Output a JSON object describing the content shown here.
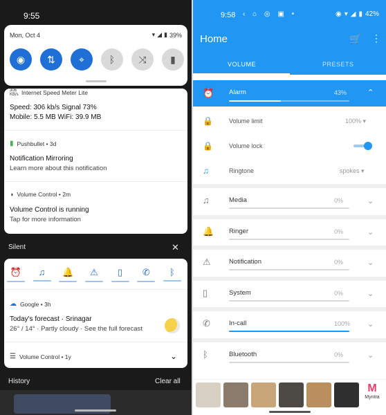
{
  "left": {
    "status_time": "9:55",
    "quick_settings": {
      "date": "Mon, Oct 4",
      "battery": "39%",
      "tiles": [
        {
          "name": "wifi-tile",
          "icon": "wifi-icon",
          "state": "on",
          "glyph": "◉"
        },
        {
          "name": "data-tile",
          "icon": "mobile-data-icon",
          "state": "on",
          "glyph": "⇅"
        },
        {
          "name": "location-tile",
          "icon": "location-icon",
          "state": "on",
          "glyph": "⌖"
        },
        {
          "name": "bluetooth-tile",
          "icon": "bluetooth-icon",
          "state": "off",
          "glyph": "ᛒ"
        },
        {
          "name": "autorotate-tile",
          "icon": "rotate-icon",
          "state": "off",
          "glyph": "⤨"
        },
        {
          "name": "flashlight-tile",
          "icon": "flashlight-icon",
          "state": "off",
          "glyph": "▮"
        }
      ]
    },
    "speed_notif": {
      "app": "Internet Speed Meter Lite",
      "app_badge": "306 KB/s",
      "line1": "Speed: 306 kb/s    Signal 73%",
      "line2": "Mobile: 5.5 MB    WiFi: 39.9 MB"
    },
    "pushbullet_notif": {
      "app": "Pushbullet • 3d",
      "title": "Notification Mirroring",
      "body": "Learn more about this notification"
    },
    "volume_notif": {
      "app": "Volume Control • 2m",
      "title": "Volume Control is running",
      "body": "Tap for more information"
    },
    "silent_label": "Silent",
    "silent_close": "✕",
    "volume_icons": [
      "⏰",
      "♫",
      "🔔",
      "⚠",
      "▯",
      "✆",
      "ᛒ"
    ],
    "google_notif": {
      "app": "Google • 3h",
      "title": "Today's forecast · Srinagar",
      "body": "26° / 14° · Partly cloudy · See the full forecast"
    },
    "vc_notif": {
      "app": "Volume Control • 1y",
      "chevron": "⌄"
    },
    "history": "History",
    "clear_all": "Clear all"
  },
  "right": {
    "status_time": "9:58",
    "status_icons_left": "‹ ⌂ ◎ ▣ •",
    "battery": "42%",
    "app_title": "Home",
    "tabs": [
      "VOLUME",
      "PRESETS"
    ],
    "alarm": {
      "label": "Alarm",
      "pct": "43%",
      "level": 0.43
    },
    "alarm_sub": {
      "volume_limit": {
        "label": "Volume limit",
        "value": "100% ▾"
      },
      "volume_lock": {
        "label": "Volume lock",
        "state": "on"
      },
      "ringtone": {
        "label": "Ringtone",
        "value": "spokes ▾"
      }
    },
    "streams": [
      {
        "key": "media",
        "label": "Media",
        "pct": "0%",
        "level": 0.0,
        "icon": "music-note-icon",
        "glyph": "♫"
      },
      {
        "key": "ringer",
        "label": "Ringer",
        "pct": "0%",
        "level": 0.0,
        "icon": "bell-icon",
        "glyph": "🔔"
      },
      {
        "key": "notification",
        "label": "Notification",
        "pct": "0%",
        "level": 0.0,
        "icon": "warning-icon",
        "glyph": "⚠"
      },
      {
        "key": "system",
        "label": "System",
        "pct": "0%",
        "level": 0.0,
        "icon": "phone-device-icon",
        "glyph": "▯"
      },
      {
        "key": "in-call",
        "label": "In-call",
        "pct": "100%",
        "level": 1.0,
        "icon": "phone-call-icon",
        "glyph": "✆"
      },
      {
        "key": "bluetooth",
        "label": "Bluetooth",
        "pct": "0%",
        "level": 0.0,
        "icon": "bluetooth-icon",
        "glyph": "ᛒ"
      }
    ],
    "ad_brand": "Myntra",
    "colors": {
      "accent": "#2196f3"
    }
  }
}
